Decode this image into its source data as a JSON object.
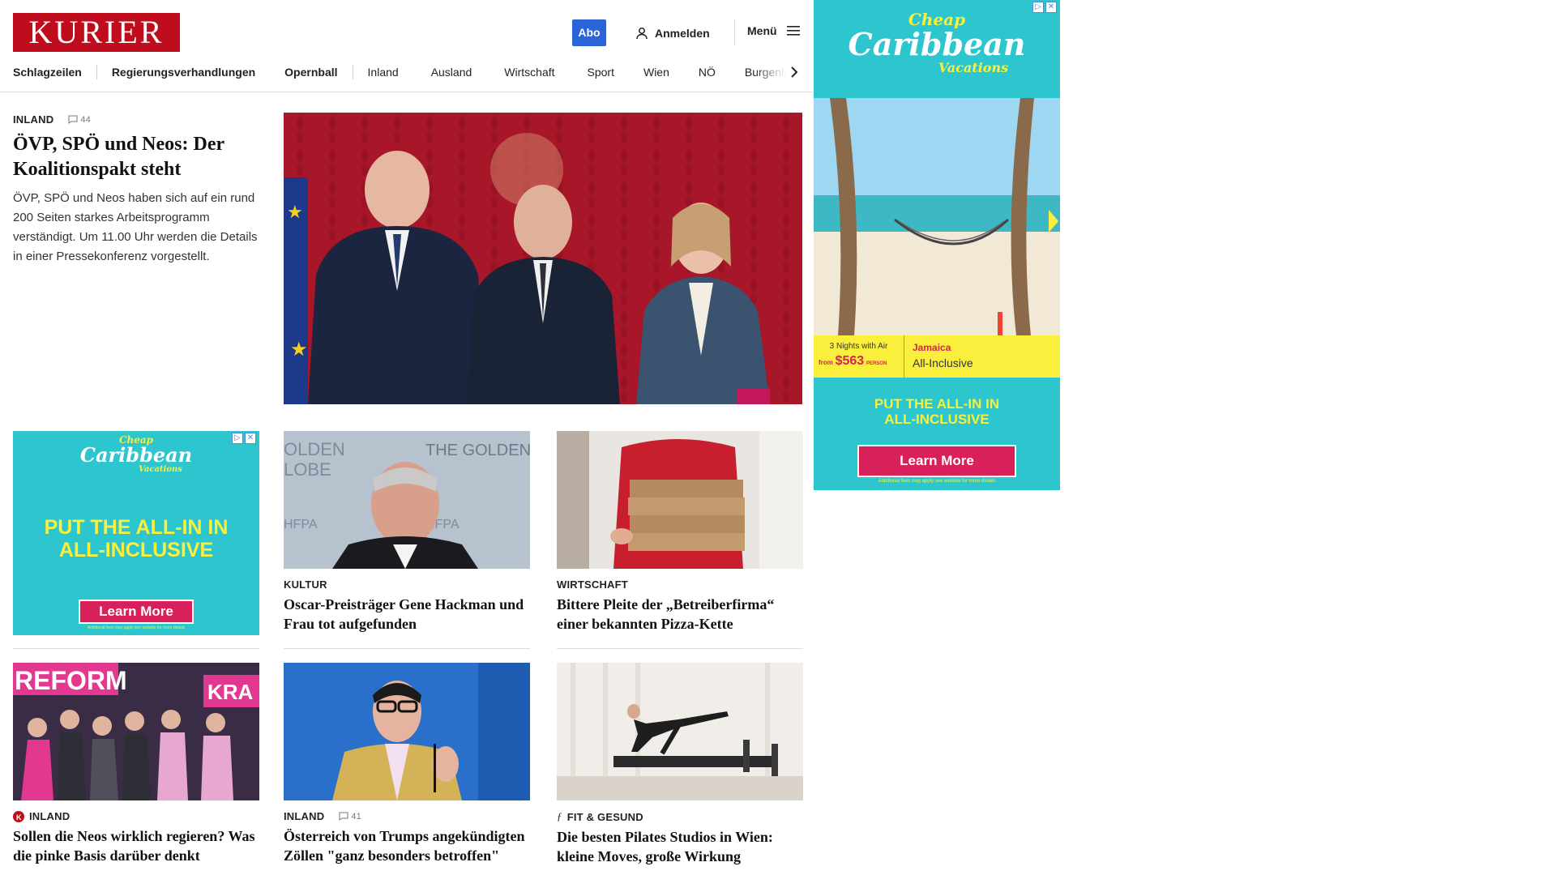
{
  "header": {
    "logo": "KURIER",
    "abo_label": "Abo",
    "login_label": "Anmelden",
    "menu_label": "Menü"
  },
  "nav": {
    "items": [
      "Schlagzeilen",
      "Regierungsverhandlungen",
      "Opernball",
      "Inland",
      "Ausland",
      "Wirtschaft",
      "Sport",
      "Wien",
      "NÖ",
      "Burgenla"
    ]
  },
  "lead": {
    "kicker": "INLAND",
    "comments": "44",
    "title": "ÖVP, SPÖ und Neos: Der Koalitionspakt steht",
    "teaser": "ÖVP, SPÖ und Neos haben sich auf ein rund 200 Seiten starkes Arbeitsprogramm verständigt. Um 11.00 Uhr werden die Details in einer Pressekonferenz vorgestellt."
  },
  "ad_side": {
    "logo_top": "Cheap",
    "logo_main": "Caribbean",
    "logo_sub": "Vacations",
    "nights": "3 Nights with Air",
    "from": "from",
    "price": "$563",
    "per": "PERSON",
    "dest": "Jamaica",
    "dest_sub": "All-Inclusive",
    "cta_line1": "PUT THE ALL-IN IN",
    "cta_line2": "ALL-INCLUSIVE",
    "button": "Learn More",
    "fine": "Additional fees may apply see website for more details"
  },
  "ad_small": {
    "logo_top": "Cheap",
    "logo_main": "Caribbean",
    "logo_sub": "Vacations",
    "cta_line1": "PUT THE ALL-IN IN",
    "cta_line2": "ALL-INCLUSIVE",
    "button": "Learn More",
    "fine": "Additional fees may apply see website for more details"
  },
  "cards": [
    {
      "kicker": "KULTUR",
      "title": "Oscar-Preisträger Gene Hackman und Frau tot aufgefunden"
    },
    {
      "kicker": "WIRTSCHAFT",
      "title": "Bittere Pleite der „Betreiberfirma“ einer bekannten Pizza-Kette"
    },
    {
      "kicker": "INLAND",
      "title": "Sollen die Neos wirklich regieren? Was die pinke Basis darüber denkt"
    },
    {
      "kicker": "INLAND",
      "comments": "41",
      "title": "Österreich von Trumps angekündigten Zöllen \"ganz besonders betroffen\""
    },
    {
      "kicker": "FIT & GESUND",
      "title": "Die besten Pilates Studios in Wien: kleine Moves, große Wirkung"
    }
  ],
  "image_text": {
    "golden_globe": "THE GOLDEN GLOBE",
    "hfpa": "HFPA",
    "reform": "REFORM",
    "kra": "KRA"
  },
  "colors": {
    "brand_red": "#c00d1e",
    "abo_blue": "#2b63d9",
    "ad_teal": "#2dc6cf",
    "ad_pink": "#d8205a",
    "ad_yellow": "#f9ef3c"
  }
}
